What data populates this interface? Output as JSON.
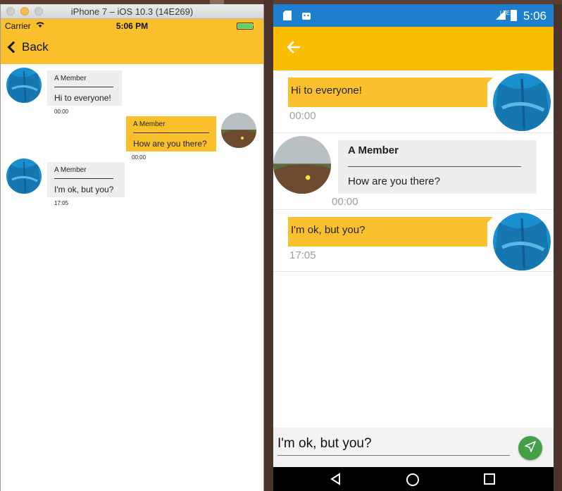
{
  "ios": {
    "window_title": "iPhone 7 – iOS 10.3 (14E269)",
    "carrier": "Carrier",
    "time": "5:06 PM",
    "back_label": "Back",
    "messages": [
      {
        "author": "A Member",
        "text": "Hi to everyone!",
        "time": "00:00",
        "own": false
      },
      {
        "author": "A Member",
        "text": "How are you there?",
        "time": "00:00",
        "own": true
      },
      {
        "author": "A Member",
        "text": "I'm ok, but you?",
        "time": "17:05",
        "own": false
      }
    ]
  },
  "android": {
    "time": "5:06",
    "network": "LTE",
    "messages": [
      {
        "text": "Hi to everyone!",
        "time": "00:00",
        "own": true
      },
      {
        "author": "A Member",
        "text": "How are you there?",
        "time": "00:00",
        "own": false
      },
      {
        "text": "I'm ok, but you?",
        "time": "17:05",
        "own": true
      }
    ],
    "input_value": "I'm ok, but you?"
  },
  "colors": {
    "ios_bar": "#f9c02b",
    "android_toolbar": "#fbbd00",
    "android_status": "#1e7fcf",
    "own_bubble": "#fbc02d",
    "other_bubble": "#eeeeee",
    "send_button": "#43a047"
  },
  "icons": {
    "back": "chevron-left-icon",
    "android_back": "arrow-left-icon",
    "send": "send-icon",
    "wifi": "wifi-icon",
    "battery": "battery-icon",
    "sd_card": "sd-card-icon",
    "android_robot": "android-icon",
    "nav_back": "triangle-back-icon",
    "nav_home": "circle-home-icon",
    "nav_recent": "square-recent-icon"
  }
}
